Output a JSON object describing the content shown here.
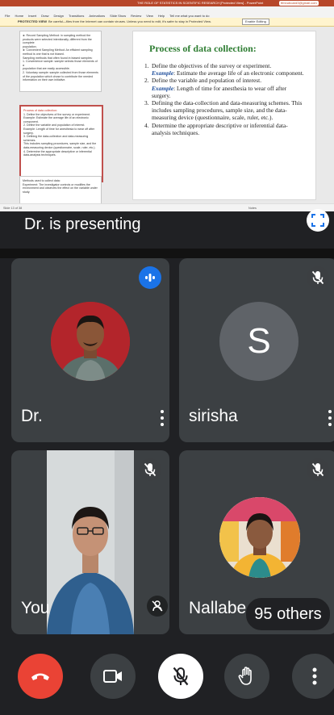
{
  "ppt": {
    "window_title": "THE ROLE OF STATISTICS IN SCIENTIFIC RESEARCH [Protected View] - PowerPoint",
    "account": "tfmnuboard3@gmail.com",
    "tabs": [
      "File",
      "Home",
      "Insert",
      "Draw",
      "Design",
      "Transitions",
      "Animations",
      "Slide Show",
      "Review",
      "View",
      "Help",
      "Tell me what you want to do"
    ],
    "warning_label": "PROTECTED VIEW",
    "warning_text": "Be careful—files from the Internet can contain viruses. Unless you need to edit, it's safer to stay in Protected View.",
    "enable_editing": "Enable Editing",
    "thumb1": {
      "lines": [
        "► Record Sampling Method: in sampling method the",
        "products were selected intentionally, different from the complete",
        "population.",
        "► Convenient Sampling Method: An efficient sampling",
        "method is one that is not biased.",
        "Sampling methods that often found in biased samples:",
        "1. Convenience sample: sample selects those elements of a",
        "population that are easily accessible.",
        "2. Voluntary sample: sample collected from those elements",
        "of the population which chose to contribute the needed",
        "information on their own initiative."
      ]
    },
    "thumb2": {
      "title": "Process of data collection:",
      "lines": [
        "1. Define the objectives of the survey or experiment.",
        "Example: Estimate the average life of an electronic",
        "component.",
        "2. Define the variable and population of interest.",
        "Example: Length of time for anesthesia to wear off after",
        "surgery.",
        "3. Defining the data-collection and data-measuring schemes.",
        "This includes sampling procedures, sample size, and the",
        "data-measuring device (questionnaire, scale, ruler, etc.).",
        "4. Determine the appropriate descriptive or inferential",
        "data-analysis techniques."
      ]
    },
    "thumb3": {
      "lines": [
        "Methods used to collect data:",
        "Experiment: The investigator controls or modifies the",
        "environment and observes the effect on the variable under",
        "study."
      ]
    },
    "slide_title": "Process of data collection:",
    "items": [
      {
        "n": "1.",
        "text": "Define the objectives of the survey or experiment.",
        "ex_label": "Example",
        "ex_text": ": Estimate the average life of an electronic component."
      },
      {
        "n": "2.",
        "text": "Define the variable and population of interest.",
        "ex_label": "Example",
        "ex_text": ": Length of time for anesthesia to wear off after surgery."
      },
      {
        "n": "3.",
        "text": "Defining the data-collection and data-measuring schemes. This includes sampling procedures, sample size, and the data-measuring device (questionnaire, scale, ruler, etc.).",
        "ex_label": "",
        "ex_text": ""
      },
      {
        "n": "4.",
        "text": "Determine the appropriate descriptive or inferential data-analysis techniques.",
        "ex_label": "",
        "ex_text": ""
      }
    ],
    "status_left": "Slide 13 of 38",
    "status_right": "Notes"
  },
  "presenting_label": "Dr. is presenting",
  "tiles": {
    "t1": {
      "name": "Dr."
    },
    "t2": {
      "name": "sirisha",
      "initial": "S"
    },
    "t3": {
      "name": "You"
    },
    "t4": {
      "name": "Nallabe"
    }
  },
  "others_label": "95 others",
  "colors": {
    "end_call": "#ea4335",
    "speaking": "#1a73e8",
    "tile": "#3c4043"
  }
}
